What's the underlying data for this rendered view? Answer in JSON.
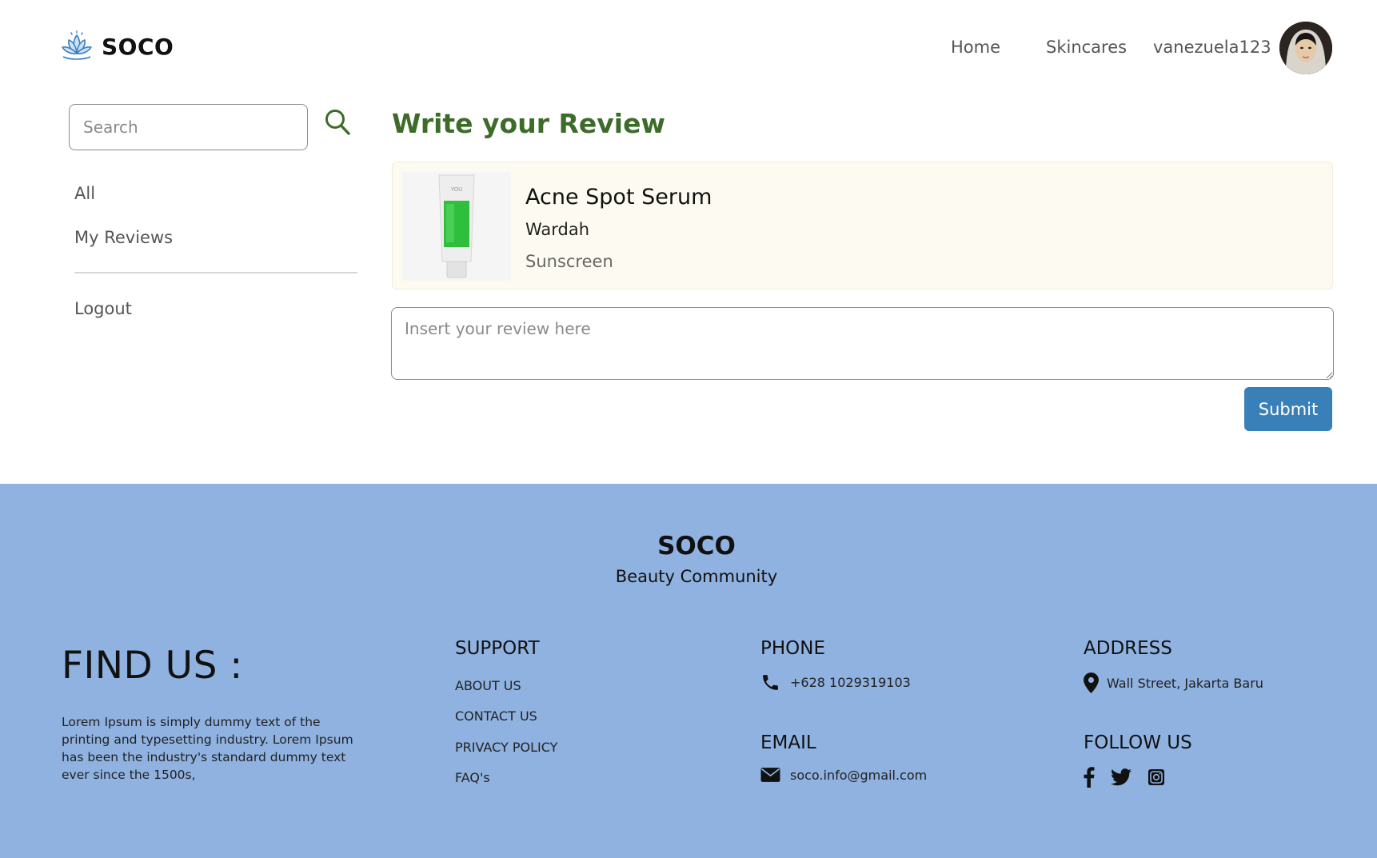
{
  "header": {
    "brand": "SOCO",
    "nav": {
      "home": "Home",
      "skincares": "Skincares",
      "username": "vanezuela123"
    }
  },
  "sidebar": {
    "search_placeholder": "Search",
    "items": [
      {
        "label": "All"
      },
      {
        "label": "My Reviews"
      }
    ],
    "logout": "Logout"
  },
  "main": {
    "title": "Write your Review",
    "product": {
      "name": "Acne Spot Serum",
      "brand": "Wardah",
      "category": "Sunscreen",
      "tube_brand": "YOU"
    },
    "review_placeholder": "Insert your review here",
    "submit": "Submit"
  },
  "footer": {
    "brand": "SOCO",
    "tagline": "Beauty Community",
    "find_us": {
      "title": "FIND US :",
      "text": "Lorem Ipsum is simply dummy text of the printing and typesetting industry. Lorem Ipsum has been the industry's standard dummy text ever since the 1500s,"
    },
    "support": {
      "title": "SUPPORT",
      "links": [
        "ABOUT US",
        "CONTACT US",
        "PRIVACY POLICY",
        "FAQ's"
      ]
    },
    "phone": {
      "title": "PHONE",
      "value": "+628 1029319103"
    },
    "email": {
      "title": "EMAIL",
      "value": "soco.info@gmail.com"
    },
    "address": {
      "title": "ADDRESS",
      "value": "Wall Street, Jakarta Baru"
    },
    "follow": {
      "title": "FOLLOW US",
      "icons": [
        "facebook-icon",
        "twitter-icon",
        "instagram-icon"
      ]
    }
  },
  "colors": {
    "title_green": "#3d6b2a",
    "submit_blue": "#3a80b8",
    "footer_bg": "#8fb2e0",
    "card_bg": "#fdfbf1"
  }
}
